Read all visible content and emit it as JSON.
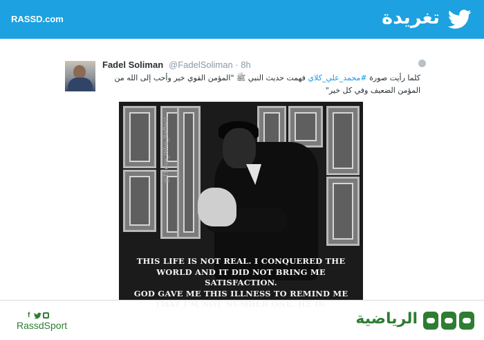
{
  "header": {
    "site_url": "RASSD.com",
    "title": "تغريدة",
    "bird_icon": "twitter-bird-icon",
    "accent_color": "#1da1e0"
  },
  "tweet": {
    "author_name": "Fadel Soliman",
    "handle": "@FadelSoliman",
    "separator": "·",
    "time": "8h",
    "globe_icon": "globe-icon",
    "text_before": "كلما رأيت صورة ",
    "hashtag": "#محمد_علي_كلاي",
    "text_after": " فهمت حديث النبي ﷺ \"المؤمن القوي خير وأحب إلى الله من المؤمن الضعيف وفي كل خير\"",
    "hashtag_color": "#1b95e0"
  },
  "tweet_image": {
    "watermark": "@Those_Who_Reflect",
    "quote_lines": [
      "THIS LIFE IS NOT REAL. I CONQUERED THE",
      "WORLD AND IT DID NOT BRING ME SATISFACTION.",
      "GOD GAVE ME THIS ILLNESS TO REMIND ME",
      "THAT I'M NOT NUMBER ONE. HE IS."
    ]
  },
  "footer": {
    "social_icons": [
      "facebook-icon",
      "twitter-icon",
      "instagram-icon"
    ],
    "handle": "RassdSport",
    "section_title": "الرياضية",
    "brand_color": "#2e7d32"
  }
}
